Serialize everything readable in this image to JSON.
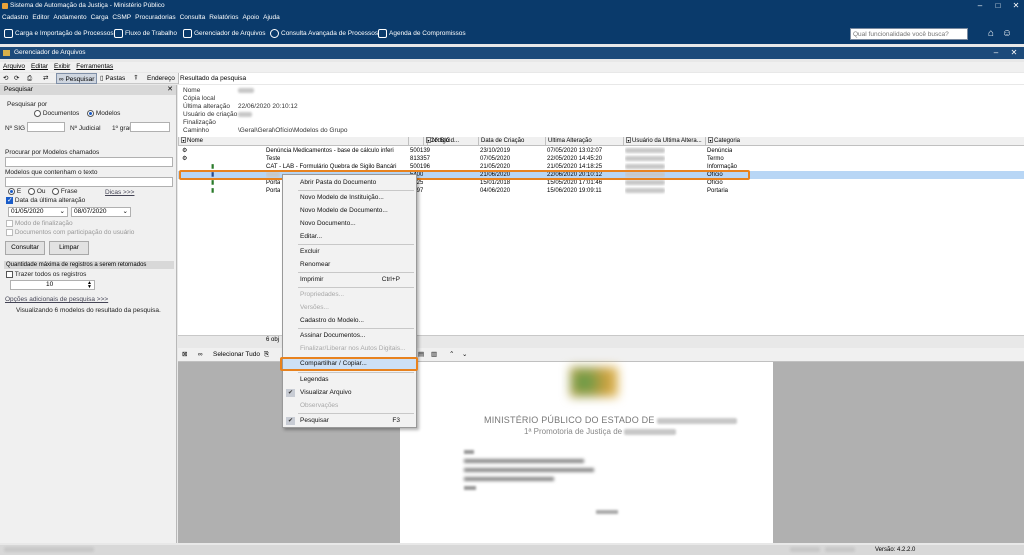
{
  "window": {
    "title": "Sistema de Automação da Justiça - Ministério Público"
  },
  "menu": [
    "Cadastro",
    "Editor",
    "Andamento",
    "Carga",
    "CSMP",
    "Procuradorias",
    "Consulta",
    "Relatórios",
    "Apoio",
    "Ajuda"
  ],
  "toolbar": {
    "items": [
      "Carga e Importação de Processos",
      "Fluxo de Trabalho",
      "Gerenciador de Arquivos",
      "Consulta Avançada de Processos",
      "Agenda de Compromissos"
    ],
    "search_placeholder": "Qual funcionalidade você busca?"
  },
  "subwindow": {
    "title": "Gerenciador de Arquivos",
    "menu": [
      "Arquivo",
      "Editar",
      "Exibir",
      "Ferramentas"
    ],
    "toolbar": {
      "pesquisar": "Pesquisar",
      "pastas": "Pastas",
      "endereco": "Endereço",
      "address": "Resultado da pesquisa"
    }
  },
  "left": {
    "header": "Pesquisar",
    "pesquisar_por": "Pesquisar por",
    "opt_documentos": "Documentos",
    "opt_modelos": "Modelos",
    "nsig": "Nº SIG",
    "njudicial": "Nº Judicial",
    "grau": "1º grau",
    "procurar": "Procurar por Modelos chamados",
    "contenham": "Modelos que contenham o texto",
    "opt_e": "E",
    "opt_ou": "Ou",
    "opt_frase": "Frase",
    "dicas": "Dicas >>>",
    "data_ultima": "Data da última alteração",
    "date_from": "01/05/2020",
    "date_to": "08/07/2020",
    "modo_finalizacao": "Modo de finalização",
    "docs_participacao": "Documentos com participação do usuário",
    "btn_consultar": "Consultar",
    "btn_limpar": "Limpar",
    "qtd_max": "Quantidade máxima de registros a serem retornados",
    "trazer_todos": "Trazer todos os registros",
    "qtd_value": "10",
    "opcoes": "Opções adicionais de pesquisa >>>",
    "visualizando": "Visualizando 6 modelos do resultado da pesquisa."
  },
  "props": {
    "nome": "Nome",
    "copia_local": "Cópia local",
    "ultima_alteracao": "Última alteração",
    "ultima_alteracao_val": "22/06/2020 20:10:12",
    "usuario_criacao": "Usuário de criação",
    "finalizacao": "Finalização",
    "caminho": "Caminho",
    "caminho_val": "\\Geral\\Geral\\Ofício\\Modelos do Grupo"
  },
  "grid": {
    "columns": [
      "Nome",
      "Código d...",
      "Nº SIG",
      "Data de Criação",
      "Última Alteração",
      "Usuário da Última Altera...",
      "Categoria"
    ],
    "rows": [
      {
        "nome": "Denúncia Medicamentos - base de cálculo inferi",
        "codigo": "500139",
        "criacao": "23/10/2019",
        "alteracao": "07/05/2020 13:02:07",
        "categoria": "Denúncia"
      },
      {
        "nome": "Teste",
        "codigo": "813357",
        "criacao": "07/05/2020",
        "alteracao": "22/05/2020 14:45:20",
        "categoria": "Termo"
      },
      {
        "nome": "CAT - LAB - Formulário Quebra de Sigilo Bancári",
        "codigo": "500196",
        "criacao": "21/05/2020",
        "alteracao": "21/05/2020 14:18:25",
        "categoria": "Informação"
      },
      {
        "nome": "",
        "codigo": "5400",
        "criacao": "21/06/2020",
        "alteracao": "22/06/2020 20:10:12",
        "categoria": "Ofício"
      },
      {
        "nome": "Porta",
        "codigo": "5025",
        "criacao": "15/01/2018",
        "alteracao": "15/05/2020 17:01:46",
        "categoria": "Ofício"
      },
      {
        "nome": "Porta",
        "codigo": "0197",
        "criacao": "04/06/2020",
        "alteracao": "15/06/2020 19:09:11",
        "categoria": "Portaria"
      }
    ],
    "footer": "6 obj"
  },
  "preview": {
    "selecionar_tudo": "Selecionar Tudo",
    "heading1": "MINISTÉRIO PÚBLICO DO ESTADO DE",
    "heading2": "1ª Promotoria de Justiça de"
  },
  "context_menu": [
    {
      "label": "Abrir Pasta do Documento",
      "disabled": false
    },
    {
      "label": "Novo Modelo de Instituição...",
      "disabled": false
    },
    {
      "label": "Novo Modelo de Documento...",
      "disabled": false
    },
    {
      "label": "Novo Documento...",
      "disabled": false
    },
    {
      "label": "Editar...",
      "disabled": false
    },
    {
      "label": "Excluir",
      "disabled": false
    },
    {
      "label": "Renomear",
      "disabled": false
    },
    {
      "label": "Imprimir",
      "shortcut": "Ctrl+P",
      "disabled": false
    },
    {
      "label": "Propriedades...",
      "disabled": true
    },
    {
      "label": "Versões...",
      "disabled": true
    },
    {
      "label": "Cadastro do Modelo...",
      "disabled": false
    },
    {
      "label": "Assinar Documentos...",
      "disabled": false
    },
    {
      "label": "Finalizar/Liberar nos Autos Digitais...",
      "disabled": true
    },
    {
      "label": "Compartilhar / Copiar...",
      "disabled": false
    },
    {
      "label": "Legendas",
      "disabled": false
    },
    {
      "label": "Visualizar Arquivo",
      "disabled": false,
      "checked": true
    },
    {
      "label": "Observações",
      "disabled": true
    },
    {
      "label": "Pesquisar",
      "shortcut": "F3",
      "disabled": false,
      "checked": true
    }
  ],
  "status": {
    "version": "Versão: 4.2.2.0"
  },
  "colors": {
    "titlebar": "#0a3a6b",
    "highlight": "#e8821e",
    "selection": "#b8d6f5"
  }
}
